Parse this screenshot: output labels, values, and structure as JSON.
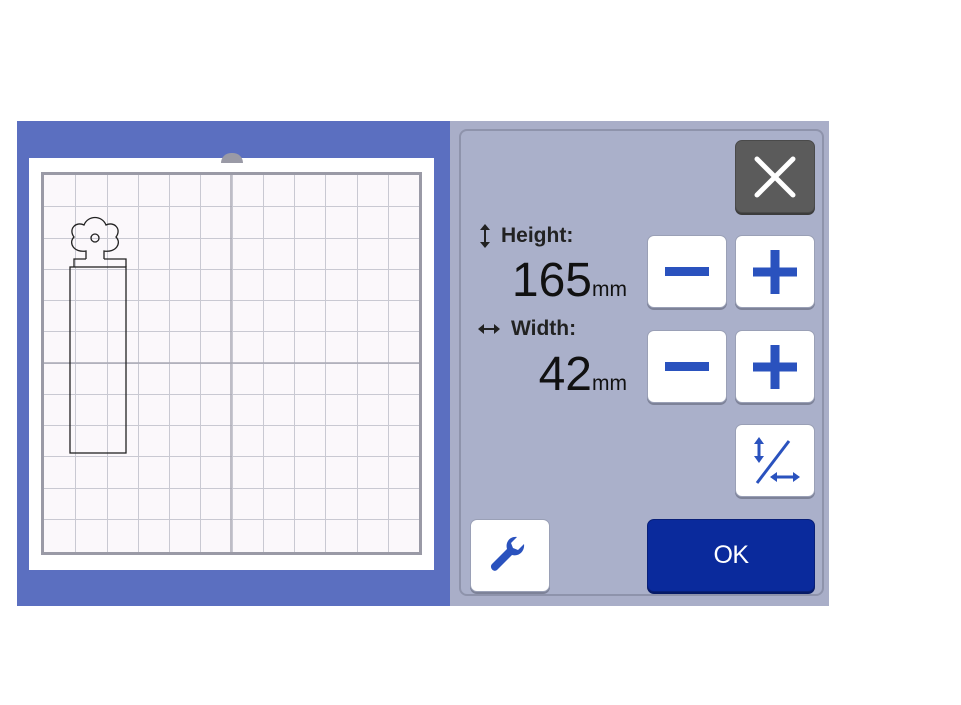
{
  "dimensions": {
    "height": {
      "label": "Height:",
      "value": "165",
      "unit": "mm",
      "icon": "vertical-arrow-icon"
    },
    "width": {
      "label": "Width:",
      "value": "42",
      "unit": "mm",
      "icon": "horizontal-arrow-icon"
    }
  },
  "buttons": {
    "ok_label": "OK",
    "close_icon": "close-icon",
    "settings_icon": "wrench-icon",
    "aspect_icon": "aspect-ratio-toggle-icon"
  },
  "colors": {
    "screen_bg": "#5b6fc0",
    "panel_bg": "#aab0ca",
    "accent_blue": "#2a52be",
    "ok_bg": "#0a2a9c",
    "close_bg": "#5b5b5b"
  }
}
